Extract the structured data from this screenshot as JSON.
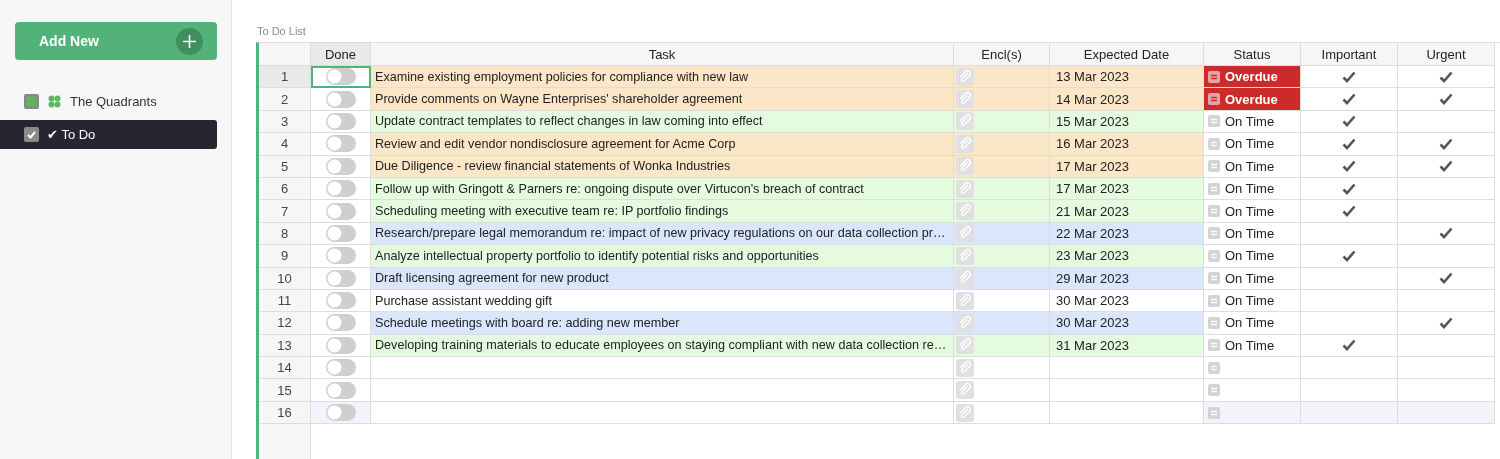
{
  "sidebar": {
    "add_button": {
      "label": "Add New"
    },
    "items": [
      {
        "label": "The Quadrants",
        "kind": "clover",
        "selected": false
      },
      {
        "label": "✔ To Do",
        "kind": "check",
        "selected": true
      }
    ]
  },
  "table": {
    "title": "To Do List",
    "columns": [
      "Done",
      "Task",
      "Encl(s)",
      "Expected Date",
      "Status",
      "Important",
      "Urgent"
    ],
    "rows": [
      {
        "number": "1",
        "done": false,
        "selected": true,
        "kind": "row",
        "color": "#fbe6c8",
        "task": "Examine existing employment policies for compliance with new law",
        "date": "13 Mar 2023",
        "status": {
          "kind": "overdue",
          "label": "Overdue"
        },
        "important": true,
        "urgent": true
      },
      {
        "number": "2",
        "done": false,
        "selected": false,
        "kind": "row",
        "color": "#fbe6c8",
        "task": "Provide comments on Wayne Enterprises' shareholder agreement",
        "date": "14 Mar 2023",
        "status": {
          "kind": "overdue",
          "label": "Overdue"
        },
        "important": true,
        "urgent": true
      },
      {
        "number": "3",
        "done": false,
        "selected": false,
        "kind": "row",
        "color": "#e4fbdf",
        "task": "Update contract templates to reflect changes in law coming into effect",
        "date": "15 Mar 2023",
        "status": {
          "kind": "on_time",
          "label": "On Time"
        },
        "important": true,
        "urgent": false
      },
      {
        "number": "4",
        "done": false,
        "selected": false,
        "kind": "row",
        "color": "#fbe6c8",
        "task": "Review and edit vendor nondisclosure agreement for Acme Corp",
        "date": "16 Mar 2023",
        "status": {
          "kind": "on_time",
          "label": "On Time"
        },
        "important": true,
        "urgent": true
      },
      {
        "number": "5",
        "done": false,
        "selected": false,
        "kind": "row",
        "color": "#fbe6c8",
        "task": "Due Diligence - review financial statements of Wonka Industries",
        "date": "17 Mar 2023",
        "status": {
          "kind": "on_time",
          "label": "On Time"
        },
        "important": true,
        "urgent": true
      },
      {
        "number": "6",
        "done": false,
        "selected": false,
        "kind": "row",
        "color": "#e4fbdf",
        "task": "Follow up with Gringott & Parners re: ongoing dispute over Virtucon's breach of contract",
        "date": "17 Mar 2023",
        "status": {
          "kind": "on_time",
          "label": "On Time"
        },
        "important": true,
        "urgent": false
      },
      {
        "number": "7",
        "done": false,
        "selected": false,
        "kind": "row",
        "color": "#e4fbdf",
        "task": "Scheduling meeting with executive team re: IP portfolio findings",
        "date": "21 Mar 2023",
        "status": {
          "kind": "on_time",
          "label": "On Time"
        },
        "important": true,
        "urgent": false
      },
      {
        "number": "8",
        "done": false,
        "selected": false,
        "kind": "row",
        "color": "#d9e6fb",
        "task": "Research/prepare legal memorandum re: impact of new privacy regulations on our data collection pr…",
        "date": "22 Mar 2023",
        "status": {
          "kind": "on_time",
          "label": "On Time"
        },
        "important": false,
        "urgent": true
      },
      {
        "number": "9",
        "done": false,
        "selected": false,
        "kind": "row",
        "color": "#e4fbdf",
        "task": "Analyze intellectual property portfolio to identify potential risks and opportunities",
        "date": "23 Mar 2023",
        "status": {
          "kind": "on_time",
          "label": "On Time"
        },
        "important": true,
        "urgent": false
      },
      {
        "number": "10",
        "done": false,
        "selected": false,
        "kind": "row",
        "color": "#d9e6fb",
        "task": "Draft licensing agreement for new product",
        "date": "29 Mar 2023",
        "status": {
          "kind": "on_time",
          "label": "On Time"
        },
        "important": false,
        "urgent": true
      },
      {
        "number": "11",
        "done": false,
        "selected": false,
        "kind": "row",
        "color": "#ffffff",
        "task": "Purchase assistant wedding gift",
        "date": "30 Mar 2023",
        "status": {
          "kind": "on_time",
          "label": "On Time"
        },
        "important": false,
        "urgent": false
      },
      {
        "number": "12",
        "done": false,
        "selected": false,
        "kind": "row",
        "color": "#d9e6fb",
        "task": "Schedule meetings with board re: adding new member",
        "date": "30 Mar 2023",
        "status": {
          "kind": "on_time",
          "label": "On Time"
        },
        "important": false,
        "urgent": true
      },
      {
        "number": "13",
        "done": false,
        "selected": false,
        "kind": "row",
        "color": "#e4fbdf",
        "task": "Developing training materials to educate employees on staying compliant with new data collection re…",
        "date": "31 Mar 2023",
        "status": {
          "kind": "on_time",
          "label": "On Time"
        },
        "important": true,
        "urgent": false
      },
      {
        "number": "14",
        "done": false,
        "selected": false,
        "kind": "row",
        "color": "#ffffff",
        "status": {
          "kind": "empty"
        },
        "important": false,
        "urgent": false
      },
      {
        "number": "15",
        "done": false,
        "selected": false,
        "kind": "row",
        "color": "#ffffff",
        "status": {
          "kind": "empty"
        },
        "important": false,
        "urgent": false
      },
      {
        "number": "16",
        "done": false,
        "selected": false,
        "kind": "new",
        "color": "#ffffff",
        "status": {
          "kind": "empty"
        },
        "important": false,
        "urgent": false
      }
    ]
  }
}
